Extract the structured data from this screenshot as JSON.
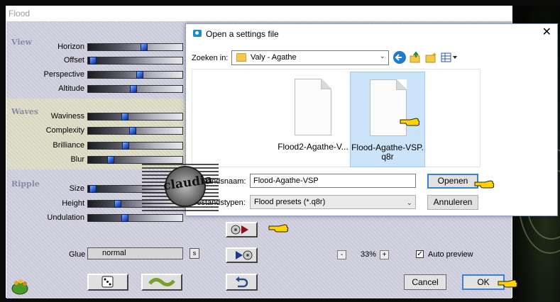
{
  "flood_window": {
    "title": "Flood",
    "groups": {
      "view": "View",
      "waves": "Waves",
      "ripple": "Ripple"
    },
    "sliders": [
      {
        "label": "Horizon",
        "value": 0.6
      },
      {
        "label": "Offset",
        "value": 0.02
      },
      {
        "label": "Perspective",
        "value": 0.55
      },
      {
        "label": "Altitude",
        "value": 0.48
      },
      {
        "label": "Waviness",
        "value": 0.38
      },
      {
        "label": "Complexity",
        "value": 0.47
      },
      {
        "label": "Brilliance",
        "value": 0.39
      },
      {
        "label": "Blur",
        "value": 0.22
      },
      {
        "label": "Size",
        "value": 0.02
      },
      {
        "label": "Height",
        "value": 0.3
      },
      {
        "label": "Undulation",
        "value": 0.38
      }
    ],
    "glue": {
      "label": "Glue",
      "value": "normal",
      "button": "s"
    },
    "zoom": {
      "minus": "-",
      "value": "33%",
      "plus": "+"
    },
    "auto_preview": {
      "label": "Auto preview",
      "checked": true
    },
    "buttons": {
      "cancel": "Cancel",
      "ok": "OK"
    }
  },
  "open_dialog": {
    "title": "Open a settings file",
    "close": "✕",
    "look_in_label": "Zoeken in:",
    "look_in_value": "Valy - Agathe",
    "files": [
      {
        "name": "Flood2-Agathe-V...",
        "selected": false
      },
      {
        "name": "Flood-Agathe-VSP.\nq8r",
        "selected": true
      }
    ],
    "file_name_label": "Bestandsnaam:",
    "file_name_value": "Flood-Agathe-VSP",
    "file_type_label": "Bestandstypen:",
    "file_type_value": "Flood presets (*.q8r)",
    "open_button": "Openen",
    "cancel_button": "Annuleren"
  },
  "watermark": {
    "text": "claudia"
  },
  "colors": {
    "accent": "#3c7fd6",
    "selection": "#cce4fa",
    "panel_bg": "#d4d4e2",
    "waves_bg": "#e0e0cc",
    "slider_thumb": "#2a5bd0"
  }
}
